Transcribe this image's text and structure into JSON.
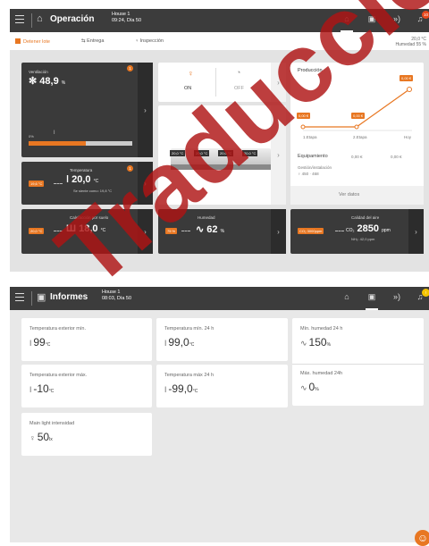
{
  "screen1": {
    "title": "Operación",
    "house": "House 1",
    "datetime": "09:24, Día 50",
    "notif_count": "10",
    "toolbar": {
      "stop": "Detener lote",
      "delivery": "Entrega",
      "inspection": "Inspección",
      "temp": "20,0 °C",
      "humidity": "Humedad 55 %"
    },
    "ventilation": {
      "label": "Ventilación",
      "value": "48,9",
      "unit": "%",
      "badge": "1",
      "bar_label": "0%",
      "bar_fill": 0.55
    },
    "light": {
      "on": "ON",
      "off": "OFF"
    },
    "temperature": {
      "label": "Temperatura",
      "tag": "19,6 °C",
      "value": "20,0",
      "unit": "°C",
      "felt": "Se siente como: 19,8 °C",
      "badge": "1"
    },
    "zones": [
      "20,0 °C",
      "20,0 °C",
      "20,0 °C",
      "20,0 °C"
    ],
    "production": {
      "title": "Producción",
      "points": [
        "0,00 €",
        "0,00 €",
        "0,00 €"
      ],
      "xlabels": [
        "1.Etapa",
        "2.Etapa",
        "Hoy"
      ],
      "row1_label": "Equipamiento",
      "row1_val1": "0,00 €",
      "row1_val2": "0,00 €",
      "row2_label": "Gestión/instalación",
      "row2_val": "450",
      "row2_val2": "468",
      "more": "Ver datos"
    },
    "heating": {
      "label": "Calefacción por suelo",
      "tag": "20,0 °C",
      "value": "18,0",
      "unit": "°C"
    },
    "humidity": {
      "label": "Humedad",
      "tag": "75 %",
      "value": "62",
      "unit": "%"
    },
    "air": {
      "label": "Calidad del aire",
      "tag": "CO₂ 3000ppm",
      "value": "2850",
      "unit": "ppm",
      "nh3": "NH₃: 42,0 ppm"
    }
  },
  "screen2": {
    "title": "Informes",
    "house": "House 1",
    "datetime": "08:03, Día 50",
    "notif_count": "!",
    "cards": [
      {
        "label": "Temperatura exterior mín.",
        "value": "99",
        "unit": "°C"
      },
      {
        "label": "Temperatura mín. 24 h",
        "value": "99,0",
        "unit": "°C"
      },
      {
        "label": "Mín. humedad 24 h",
        "value": "150",
        "unit": "%"
      },
      {
        "label": "Temperatura exterior máx.",
        "value": "-10",
        "unit": "°C"
      },
      {
        "label": "Temperatura máx 24 h",
        "value": "-99,0",
        "unit": "°C"
      },
      {
        "label": "Máx. humedad 24h",
        "value": "0",
        "unit": "%"
      },
      {
        "label": "Main light intensidad",
        "value": "50",
        "unit": "lx"
      }
    ]
  },
  "watermark": "Traducción"
}
